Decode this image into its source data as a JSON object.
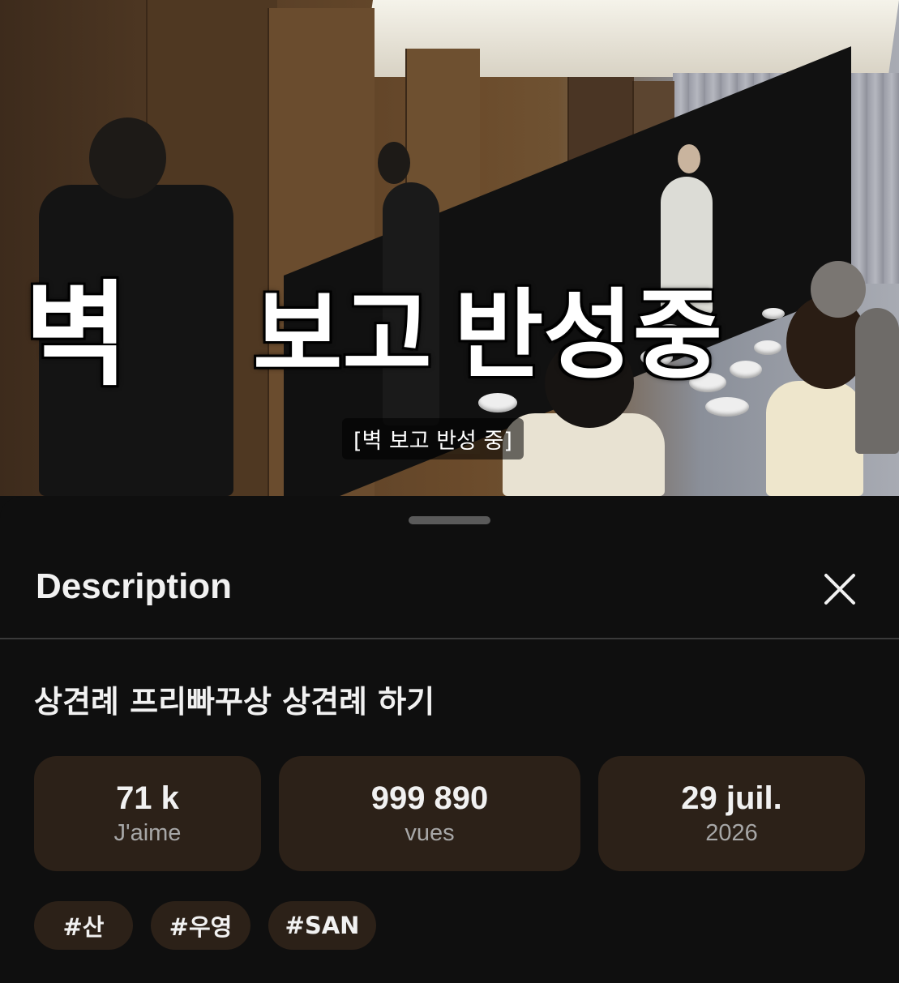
{
  "video": {
    "overlay_words": [
      "벽",
      "보고",
      "반성중"
    ],
    "caption": "[벽 보고 반성 중]"
  },
  "sheet": {
    "title": "Description",
    "close_icon": "close-icon"
  },
  "video_title": "상견례 프리빠꾸상 상견례 하기",
  "stats": [
    {
      "value": "71 k",
      "label": "J'aime"
    },
    {
      "value": "999 890",
      "label": "vues"
    },
    {
      "value": "29 juil.",
      "label": "2026"
    }
  ],
  "tags": [
    "#산",
    "#우영",
    "#SAN"
  ],
  "colors": {
    "background": "#0f0f0f",
    "chip": "#2c2118",
    "text": "#f1f1f1",
    "muted": "#a7a7a7"
  }
}
